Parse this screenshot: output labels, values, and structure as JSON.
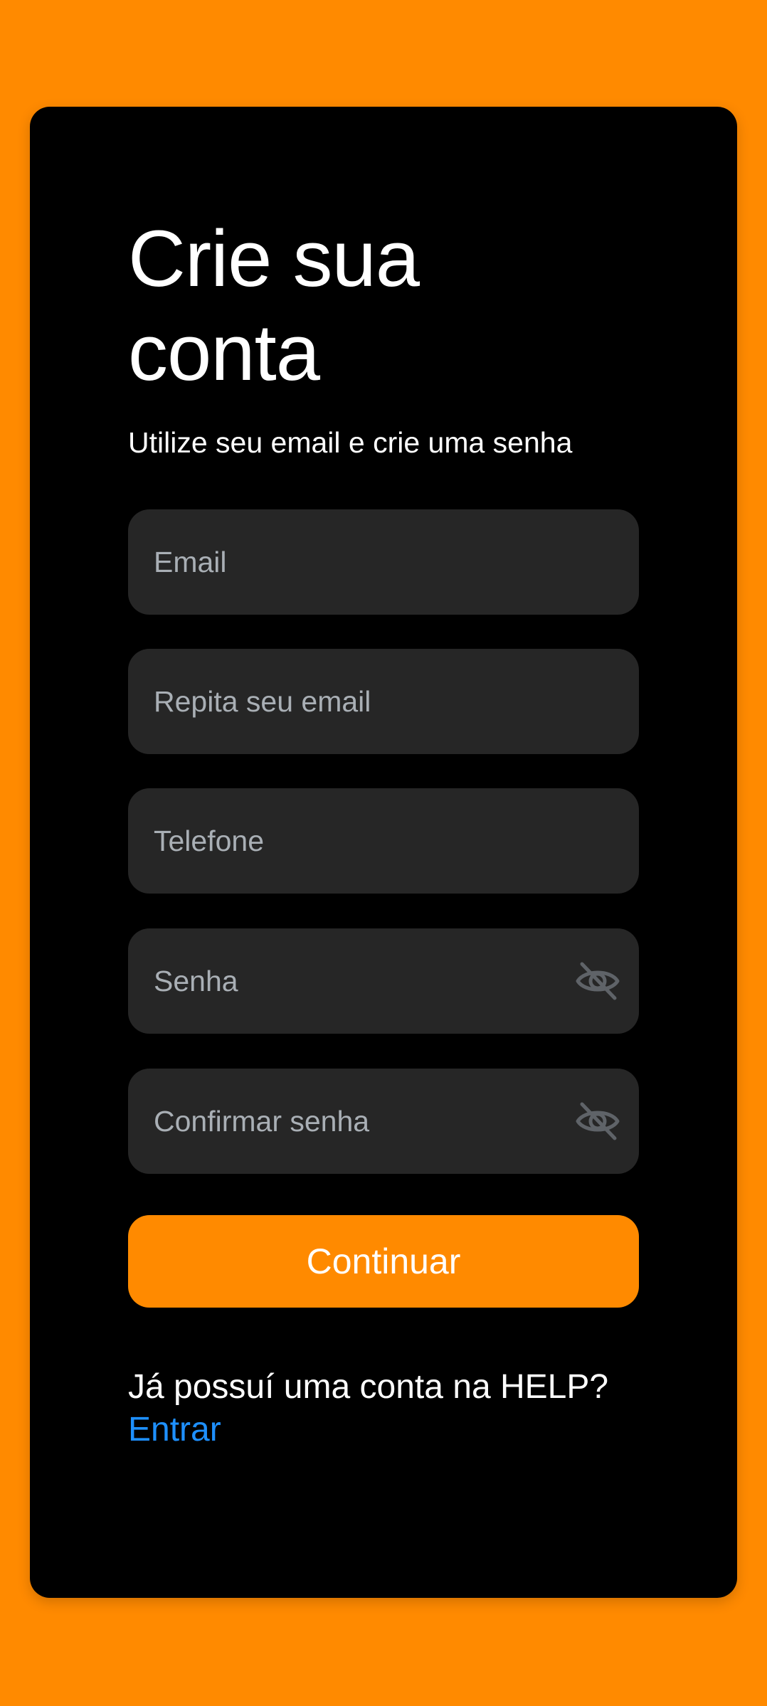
{
  "form": {
    "title": "Crie sua conta",
    "subtitle": "Utilize seu email e crie uma senha",
    "fields": {
      "email": {
        "placeholder": "Email",
        "value": ""
      },
      "email_confirm": {
        "placeholder": "Repita seu email",
        "value": ""
      },
      "phone": {
        "placeholder": "Telefone",
        "value": ""
      },
      "password": {
        "placeholder": "Senha",
        "value": "",
        "toggle_icon": "eye-off-icon"
      },
      "password_confirm": {
        "placeholder": "Confirmar senha",
        "value": "",
        "toggle_icon": "eye-off-icon"
      }
    },
    "submit_label": "Continuar"
  },
  "footer": {
    "question": "Já possuí uma conta na HELP?",
    "link_label": "Entrar"
  },
  "colors": {
    "background": "#FF8A00",
    "card": "#000000",
    "field": "#262626",
    "accent": "#FF8A00",
    "link": "#1E90FF",
    "placeholder": "#A9AFB5",
    "icon": "#5F6368"
  }
}
